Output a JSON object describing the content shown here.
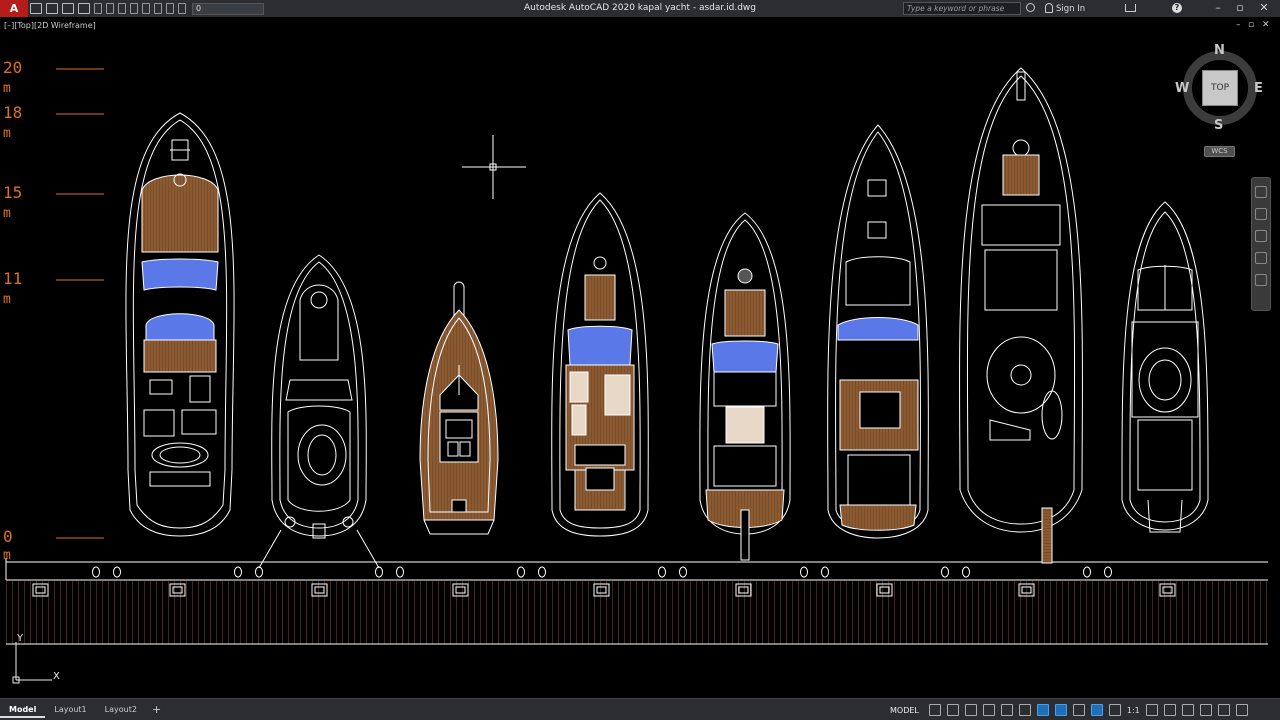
{
  "titlebar": {
    "app_logo": "A",
    "layer_value": "0",
    "title": "Autodesk AutoCAD 2020    kapal yacht - asdar.id.dwg",
    "search_placeholder": "Type a keyword or phrase",
    "sign_in": "Sign In",
    "help": "?",
    "minimize": "–",
    "restore": "▫",
    "close": "✕"
  },
  "viewport": {
    "label": "[–][Top][2D Wireframe]"
  },
  "drawing": {
    "scale_marks": [
      {
        "value": "20",
        "unit": "m"
      },
      {
        "value": "18",
        "unit": "m"
      },
      {
        "value": "15",
        "unit": "m"
      },
      {
        "value": "11",
        "unit": "m"
      },
      {
        "value": "0",
        "unit": "m"
      }
    ],
    "colors": {
      "line": "#ffffff",
      "scale": "#e07020",
      "teak": "#8a5a32",
      "teak_dark": "#6b4222",
      "cushion_blue": "#5a78e8",
      "cushion_cream": "#e8d8c8"
    }
  },
  "viewcube": {
    "top": "TOP",
    "north": "N",
    "south": "S",
    "east": "E",
    "west": "W",
    "wcs": "WCS"
  },
  "ucs": {
    "x": "X",
    "y": "Y"
  },
  "statusbar": {
    "layout_tabs": [
      "Model",
      "Layout1",
      "Layout2"
    ],
    "add_tab": "+",
    "model_button": "MODEL",
    "scale": "1:1"
  }
}
